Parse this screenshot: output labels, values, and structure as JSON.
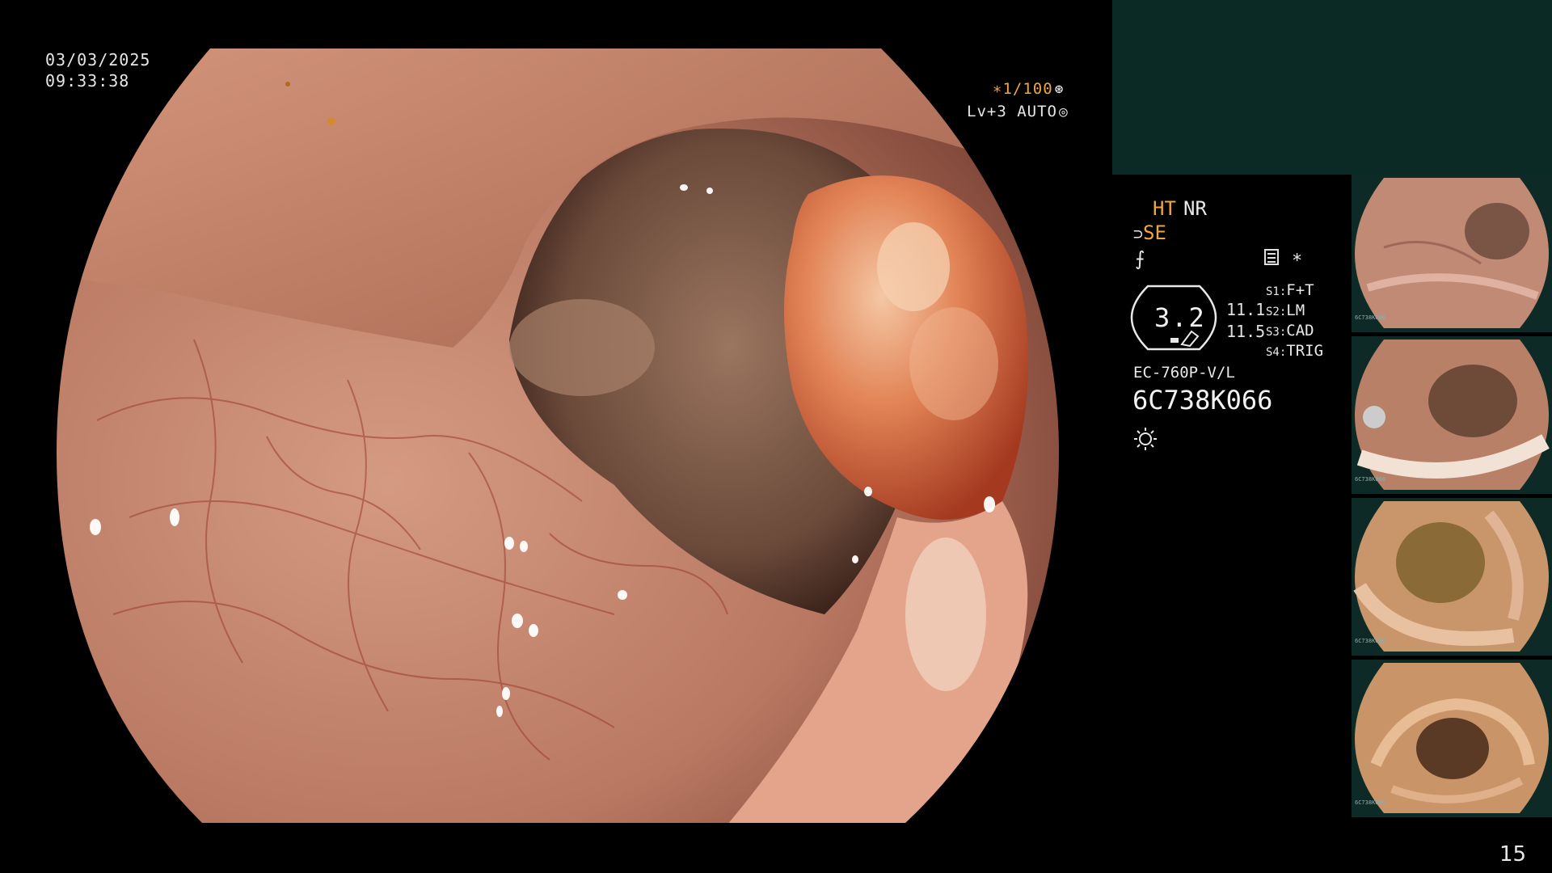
{
  "osd": {
    "date": "03/03/2025",
    "time": "09:33:38",
    "shutter": "∗1/100",
    "shutter_icon": "aperture-icon",
    "level": "Lv+3 AUTO",
    "level_icon": "auto-iris-icon"
  },
  "info_panel": {
    "ht": "HT",
    "nr": "NR",
    "se": "SE",
    "zoom": "3.2",
    "value_a": "11.1",
    "value_b": "11.5",
    "switches": [
      {
        "key": "S1:",
        "value": "F+T"
      },
      {
        "key": "S2:",
        "value": "LM"
      },
      {
        "key": "S3:",
        "value": "CAD"
      },
      {
        "key": "S4:",
        "value": "TRIG"
      }
    ],
    "model": "EC-760P-V/L",
    "serial": "6C738K066",
    "star": "∗"
  },
  "thumbnails": [
    {
      "caption": "6C738K066"
    },
    {
      "caption": "6C738K066"
    },
    {
      "caption": "6C738K066"
    },
    {
      "caption": "6C738K066"
    }
  ],
  "page_number": "15",
  "colors": {
    "accent_orange": "#f0a63c",
    "panel_teal": "#0b2a25",
    "mucosa": "#c98a72"
  }
}
